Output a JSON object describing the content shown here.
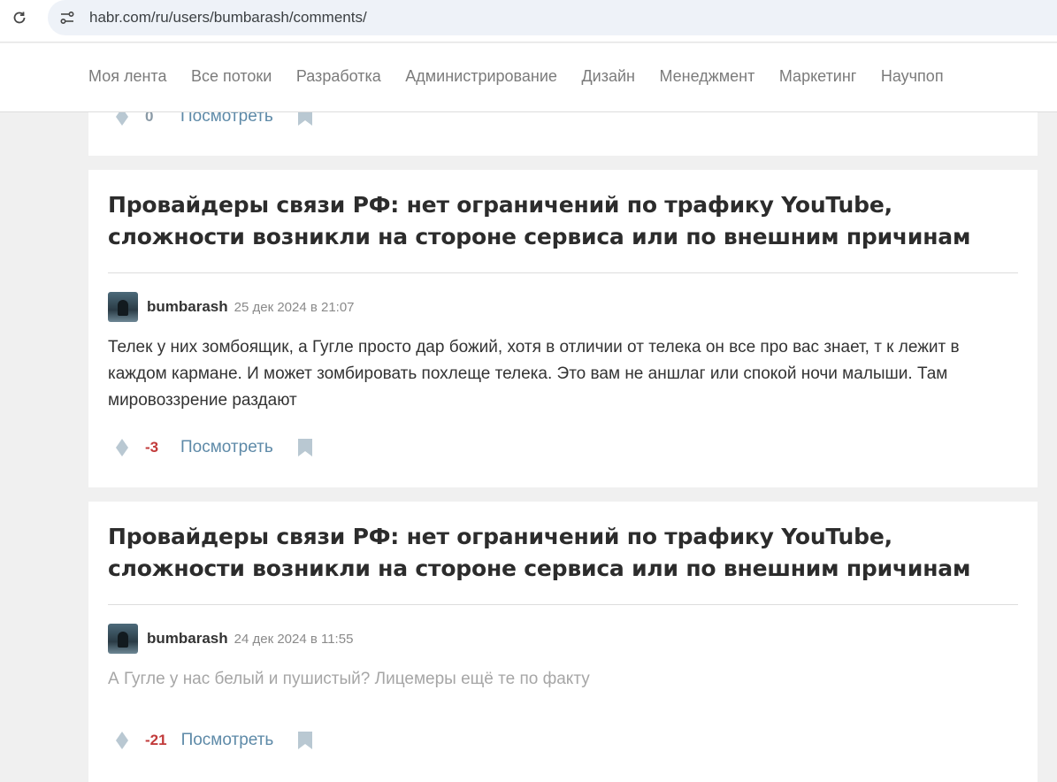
{
  "browser": {
    "url": "habr.com/ru/users/bumbarash/comments/"
  },
  "nav": {
    "items": [
      "Моя лента",
      "Все потоки",
      "Разработка",
      "Администрирование",
      "Дизайн",
      "Менеджмент",
      "Маркетинг",
      "Научпоп"
    ]
  },
  "top_card": {
    "score": "0",
    "view_label": "Посмотреть"
  },
  "comments": [
    {
      "post_title": "Провайдеры связи РФ: нет ограничений по трафику YouTube, сложности возникли на стороне сервиса или по внешним причинам",
      "username": "bumbarash",
      "date": "25 дек 2024 в 21:07",
      "text": "Телек у них зомбоящик, а Гугле просто дар божий, хотя в отличии от телека он все про вас знает, т к лежит в каждом кармане. И может зомбировать похлеще телека. Это вам не аншлаг или спокой ночи малыши. Там мировоззрение раздают",
      "score": "-3",
      "view_label": "Посмотреть"
    },
    {
      "post_title": "Провайдеры связи РФ: нет ограничений по трафику YouTube, сложности возникли на стороне сервиса или по внешним причинам",
      "username": "bumbarash",
      "date": "24 дек 2024 в 11:55",
      "text": "А Гугле у нас белый и пушистый? Лицемеры ещё те по факту",
      "score": "-21",
      "view_label": "Посмотреть"
    }
  ],
  "colors": {
    "negative_score": "#c23b3b",
    "link": "#5e8aa8",
    "icon": "#b9c8d2"
  }
}
